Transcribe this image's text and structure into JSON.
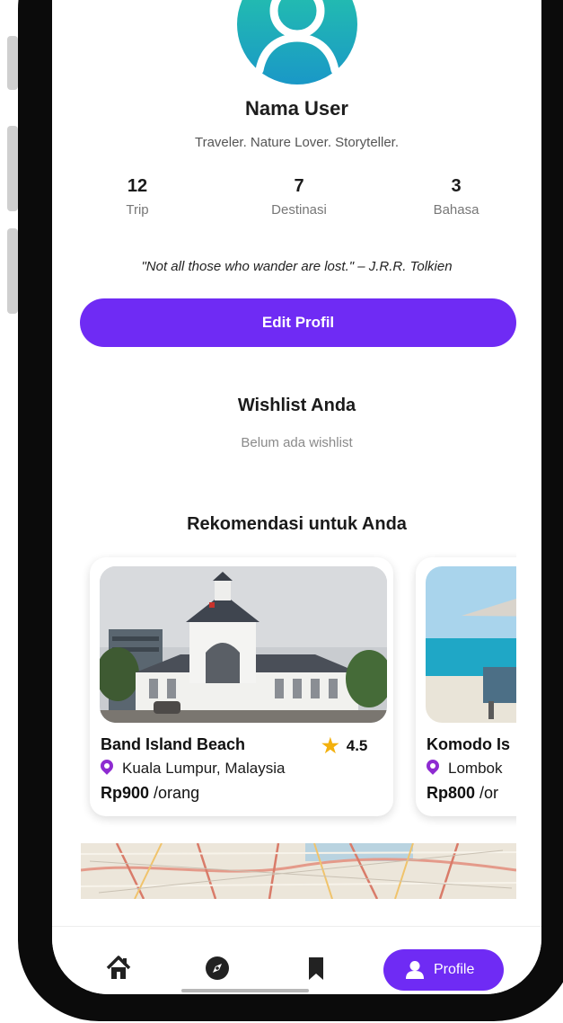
{
  "profile": {
    "name": "Nama User",
    "bio": "Traveler. Nature Lover. Storyteller.",
    "stats": [
      {
        "value": "12",
        "label": "Trip"
      },
      {
        "value": "7",
        "label": "Destinasi"
      },
      {
        "value": "3",
        "label": "Bahasa"
      }
    ],
    "quote": "\"Not all those who wander are lost.\" – J.R.R. Tolkien",
    "edit_button": "Edit Profil"
  },
  "wishlist": {
    "title": "Wishlist Anda",
    "empty_text": "Belum ada wishlist"
  },
  "recommendations": {
    "title": "Rekomendasi untuk Anda",
    "cards": [
      {
        "name": "Band Island Beach",
        "rating": "4.5",
        "location": "Kuala Lumpur, Malaysia",
        "price": "Rp900",
        "unit": "/orang"
      },
      {
        "name": "Komodo Is",
        "rating": "",
        "location": "Lombok",
        "price": "Rp800",
        "unit": "/or"
      }
    ]
  },
  "nav": {
    "items": [
      {
        "icon": "home-icon"
      },
      {
        "icon": "compass-icon"
      },
      {
        "icon": "bookmark-icon"
      },
      {
        "icon": "user-icon",
        "label": "Profile",
        "active": true
      }
    ]
  },
  "colors": {
    "primary": "#6f2bf4",
    "avatar_gradient_start": "#25c8a8",
    "avatar_gradient_end": "#1a98c7",
    "star": "#f3b10e",
    "pin": "#8e2bd1"
  }
}
